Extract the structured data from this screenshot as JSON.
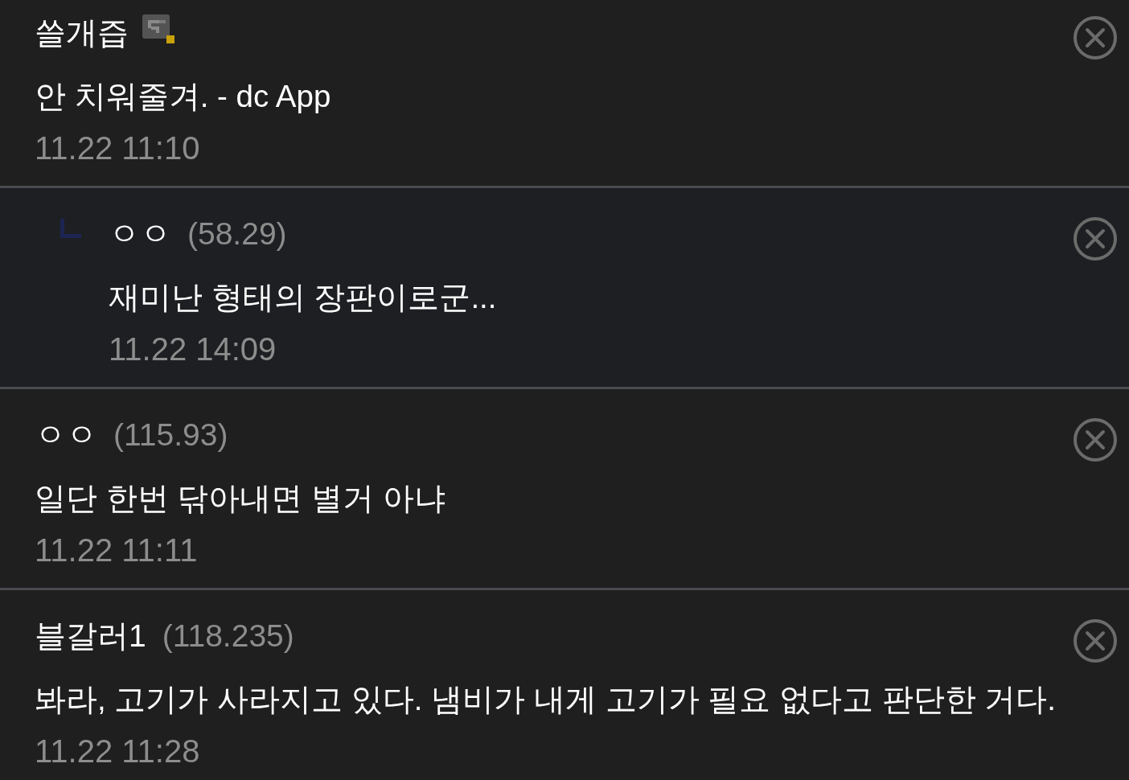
{
  "comments": [
    {
      "kind": "comment",
      "name": "쓸개즙",
      "nick_icon": true,
      "text": "안 치워줄겨. - dc App",
      "date": "11.22 11:10"
    },
    {
      "kind": "reply",
      "name": "ㅇㅇ",
      "ip": "(58.29)",
      "nick_icon": false,
      "text": "재미난 형태의 장판이로군...",
      "date": "11.22 14:09"
    },
    {
      "kind": "comment",
      "name": "ㅇㅇ",
      "ip": "(115.93)",
      "nick_icon": false,
      "text": "일단 한번 닦아내면 별거 아냐",
      "date": "11.22 11:11"
    },
    {
      "kind": "comment",
      "name": "블갈러1",
      "ip": "(118.235)",
      "nick_icon": false,
      "text": "봐라, 고기가 사라지고 있다. 냄비가 내게 고기가 필요 없다고 판단한 거다.",
      "date": "11.22 11:28"
    }
  ]
}
